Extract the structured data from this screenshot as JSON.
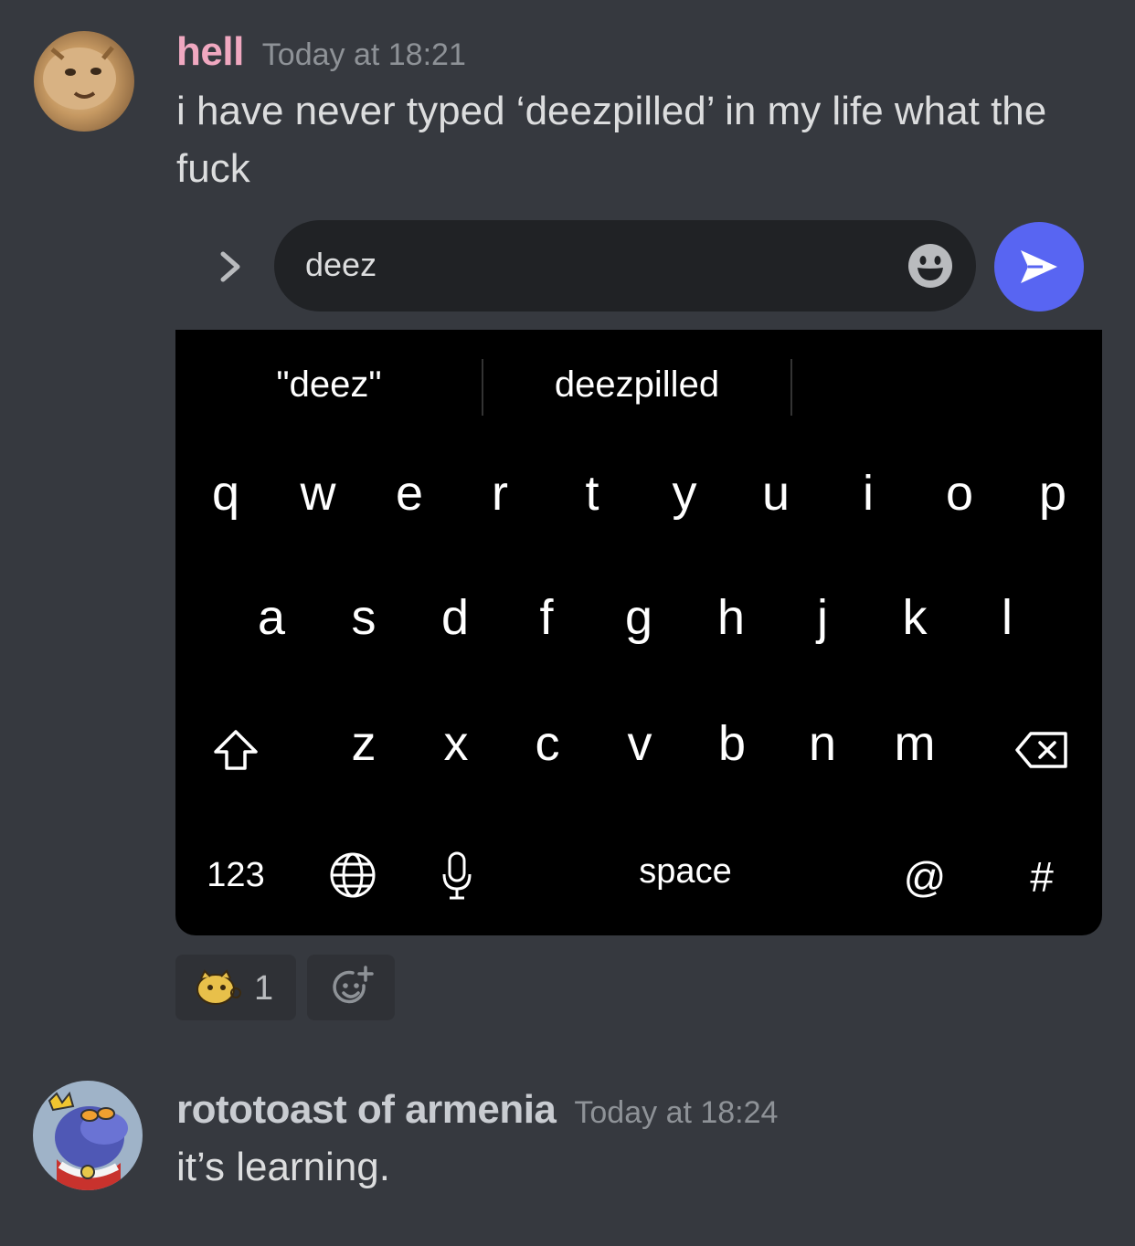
{
  "messages": [
    {
      "author": "hell",
      "author_color": "#f0a8c0",
      "time": "Today at 18:21",
      "text": "i have never typed ‘deezpilled’ in my life what the fuck"
    },
    {
      "author": "rototoast of armenia",
      "author_color": "#c9ccd1",
      "time": "Today at 18:24",
      "text": "it’s learning."
    }
  ],
  "composer": {
    "value": "deez",
    "expand_icon": "chevron-right-icon",
    "emoji_icon": "smiley-icon",
    "send_icon": "send-arrow-icon",
    "send_color": "#5865f2"
  },
  "keyboard": {
    "suggestions": [
      "\"deez\"",
      "deezpilled",
      ""
    ],
    "row1": [
      "q",
      "w",
      "e",
      "r",
      "t",
      "y",
      "u",
      "i",
      "o",
      "p"
    ],
    "row2": [
      "a",
      "s",
      "d",
      "f",
      "g",
      "h",
      "j",
      "k",
      "l"
    ],
    "row3": [
      "z",
      "x",
      "c",
      "v",
      "b",
      "n",
      "m"
    ],
    "shift_icon": "shift-icon",
    "delete_icon": "backspace-icon",
    "numbers_label": "123",
    "globe_icon": "globe-icon",
    "mic_icon": "microphone-icon",
    "space_label": "space",
    "at_label": "@",
    "hash_label": "#"
  },
  "reactions": [
    {
      "emoji_icon": "cat-emoji-icon",
      "count": "1"
    },
    {
      "emoji_icon": "add-reaction-icon",
      "count": ""
    }
  ]
}
